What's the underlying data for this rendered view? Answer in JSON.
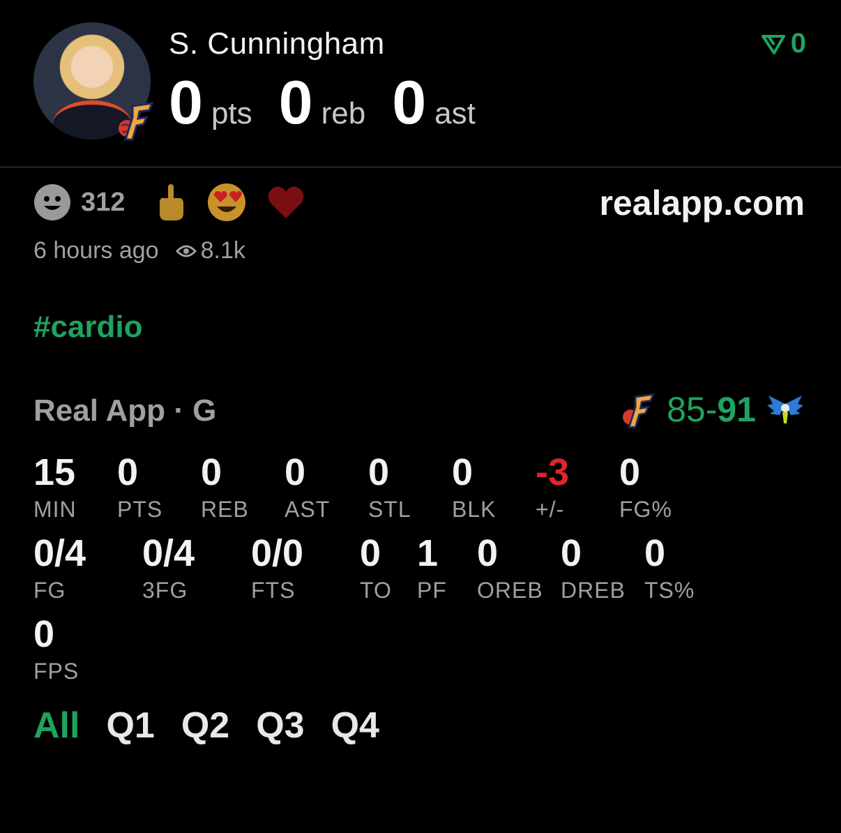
{
  "player": {
    "name": "S. Cunningham",
    "pts": "0",
    "pts_label": "pts",
    "reb": "0",
    "reb_label": "reb",
    "ast": "0",
    "ast_label": "ast"
  },
  "vote": {
    "count": "0",
    "color": "#1fa35f"
  },
  "reactions": {
    "count": "312",
    "emojis": [
      "middle-finger",
      "heart-eyes",
      "heart"
    ]
  },
  "site": "realapp.com",
  "meta": {
    "time": "6 hours ago",
    "views": "8.1k"
  },
  "hashtag": "#cardio",
  "game": {
    "title": "Real App · G",
    "score_home": "85",
    "score_sep": "-",
    "score_away": "91"
  },
  "stats_row1": [
    {
      "v": "15",
      "k": "MIN"
    },
    {
      "v": "0",
      "k": "PTS"
    },
    {
      "v": "0",
      "k": "REB"
    },
    {
      "v": "0",
      "k": "AST"
    },
    {
      "v": "0",
      "k": "STL"
    },
    {
      "v": "0",
      "k": "BLK"
    },
    {
      "v": "-3",
      "k": "+/-"
    },
    {
      "v": "0",
      "k": "FG%"
    }
  ],
  "stats_row2": [
    {
      "v": "0/4",
      "k": "FG"
    },
    {
      "v": "0/4",
      "k": "3FG"
    },
    {
      "v": "0/0",
      "k": "FTS"
    },
    {
      "v": "0",
      "k": "TO"
    },
    {
      "v": "1",
      "k": "PF"
    },
    {
      "v": "0",
      "k": "OREB"
    },
    {
      "v": "0",
      "k": "DREB"
    },
    {
      "v": "0",
      "k": "TS%"
    }
  ],
  "stats_row3": [
    {
      "v": "0",
      "k": "FPS"
    }
  ],
  "tabs": [
    "All",
    "Q1",
    "Q2",
    "Q3",
    "Q4"
  ],
  "colors": {
    "accent": "#1fa35f",
    "negative": "#e0242b",
    "muted": "#a0a0a0"
  }
}
